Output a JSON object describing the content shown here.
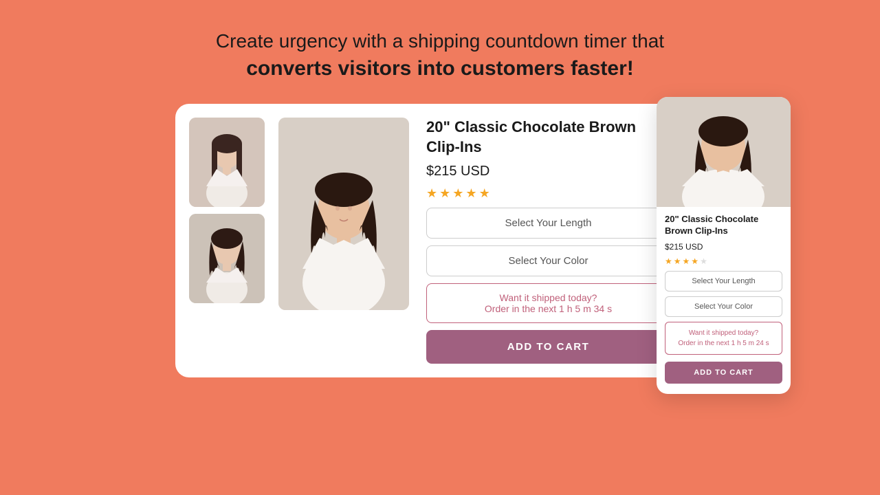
{
  "headline": {
    "line1": "Create urgency with a shipping countdown timer that",
    "line2": "converts visitors into customers faster!"
  },
  "desktop_card": {
    "product_title": "20\" Classic Chocolate Brown Clip-Ins",
    "product_price": "$215 USD",
    "stars_count": 5,
    "select_length_label": "Select Your Length",
    "select_color_label": "Select Your Color",
    "urgency_line1": "Want it shipped today?",
    "urgency_line2": "Order in the next 1 h 5 m 34 s",
    "add_to_cart_label": "ADD TO CART"
  },
  "mobile_card": {
    "product_title": "20\" Classic Chocolate Brown Clip-Ins",
    "product_price": "$215 USD",
    "stars_count": 4,
    "select_length_label": "Select Your Length",
    "select_color_label": "Select Your Color",
    "urgency_line1": "Want it shipped today?",
    "urgency_line2": "Order in the next 1 h 5 m 24 s",
    "add_to_cart_label": "ADD TO CART"
  }
}
